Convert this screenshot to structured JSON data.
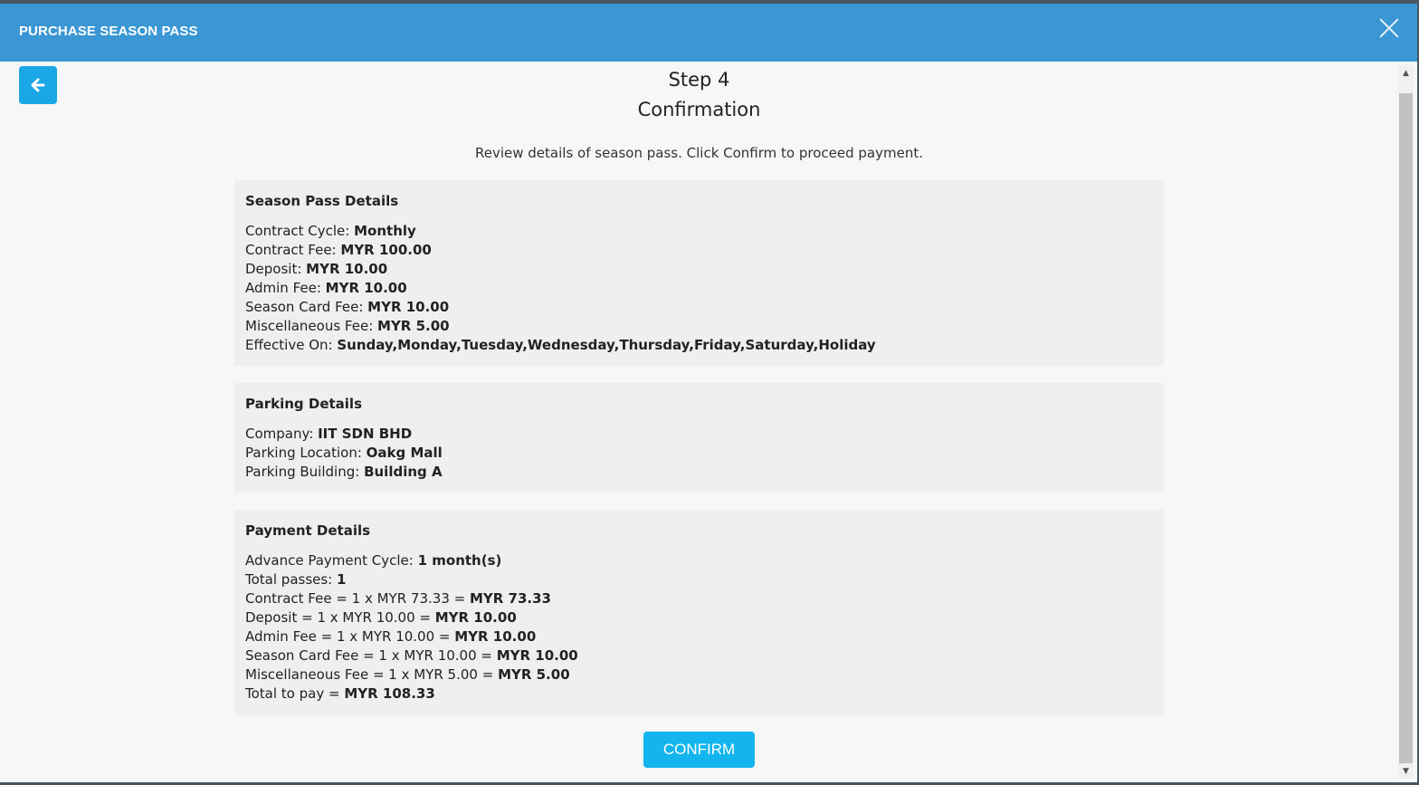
{
  "modal": {
    "title": "PURCHASE SEASON PASS"
  },
  "icons": {
    "back": "arrow-left-icon",
    "close": "close-icon"
  },
  "step": {
    "title": "Step 4",
    "subtitle": "Confirmation",
    "instruction": "Review details of season pass. Click Confirm to proceed payment."
  },
  "season_pass": {
    "heading": "Season Pass Details",
    "rows": [
      {
        "label": "Contract Cycle:  ",
        "value": "Monthly"
      },
      {
        "label": "Contract Fee: ",
        "value": "MYR 100.00"
      },
      {
        "label": "Deposit: ",
        "value": "MYR 10.00"
      },
      {
        "label": "Admin Fee: ",
        "value": "MYR 10.00"
      },
      {
        "label": "Season Card Fee: ",
        "value": "MYR 10.00"
      },
      {
        "label": "Miscellaneous Fee: ",
        "value": "MYR 5.00"
      },
      {
        "label": "Effective On: ",
        "value": "Sunday,Monday,Tuesday,Wednesday,Thursday,Friday,Saturday,Holiday"
      }
    ]
  },
  "parking": {
    "heading": "Parking Details",
    "rows": [
      {
        "label": "Company: ",
        "value": "IIT SDN BHD"
      },
      {
        "label": "Parking Location: ",
        "value": "Oakg Mall"
      },
      {
        "label": "Parking Building: ",
        "value": "Building A"
      }
    ]
  },
  "payment": {
    "heading": "Payment Details",
    "rows": [
      {
        "label": "Advance Payment Cycle: ",
        "value": "1 month(s)"
      },
      {
        "label": "Total passes: ",
        "value": "1"
      },
      {
        "label": "Contract Fee = 1 x MYR 73.33 = ",
        "value": "MYR 73.33"
      },
      {
        "label": "Deposit = 1 x MYR 10.00 = ",
        "value": "MYR 10.00"
      },
      {
        "label": "Admin Fee = 1 x MYR 10.00 = ",
        "value": "MYR 10.00"
      },
      {
        "label": "Season Card Fee = 1 x MYR 10.00 = ",
        "value": "MYR 10.00"
      },
      {
        "label": "Miscellaneous Fee = 1 x MYR 5.00 = ",
        "value": "MYR 5.00"
      },
      {
        "label": "Total to pay  =  ",
        "value": "MYR 108.33"
      }
    ]
  },
  "actions": {
    "confirm_label": "CONFIRM"
  },
  "colors": {
    "header": "#3a97d4",
    "accent_button": "#14b5ee",
    "panel": "#efefef"
  }
}
